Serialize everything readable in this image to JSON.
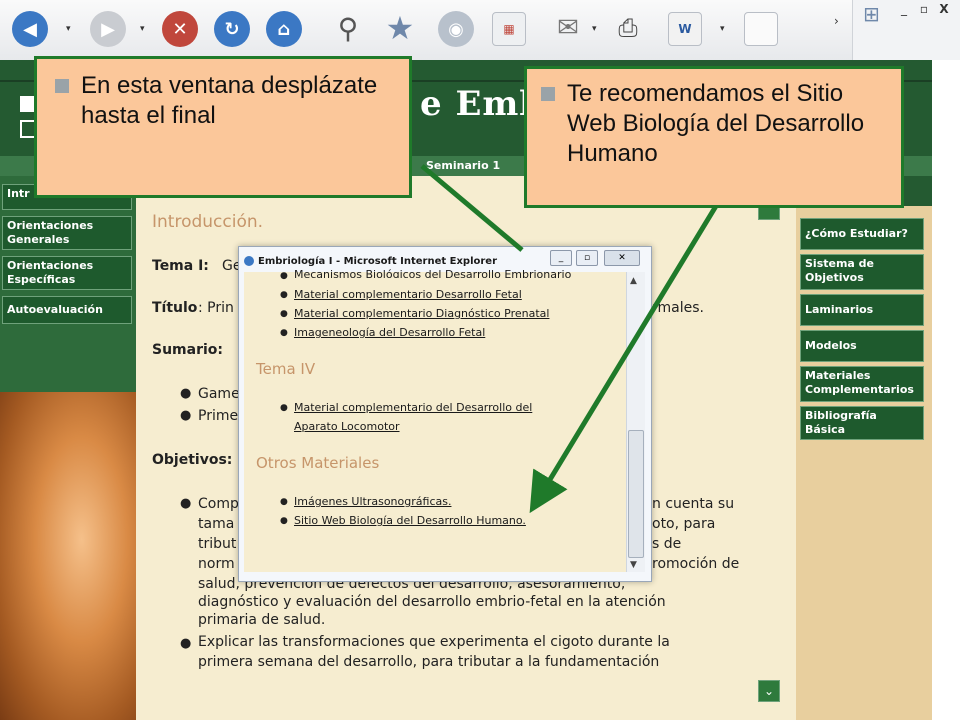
{
  "toolbar": {
    "icons": [
      "back-icon",
      "forward-icon",
      "stop-icon",
      "refresh-icon",
      "home-icon",
      "search-icon",
      "favorites-icon",
      "media-icon",
      "history-icon",
      "mail-icon",
      "print-icon",
      "edit-icon",
      "discuss-icon"
    ]
  },
  "window_controls": {
    "minimize": "_",
    "restore": "▫",
    "close": "X"
  },
  "site": {
    "header_title": "e Embr",
    "nav_tab": "Seminario 1",
    "left_nav": [
      "Intr",
      "Orientaciones Generales",
      "Orientaciones Específicas",
      "Autoevaluación"
    ],
    "right_nav": [
      "¿Cómo Estudiar?",
      "Sistema de Objetivos",
      "Laminarios",
      "Modelos",
      "Materiales Complementarios",
      "Bibliografía Básica"
    ]
  },
  "content": {
    "intro_title": "Introducción.",
    "tema_label": "Tema I:",
    "tema_value": "Ge",
    "titulo_label": "Título",
    "titulo_value": ": Prin",
    "titulo_tail": "rmales.",
    "sumario_label": "Sumario:",
    "sumario_items": [
      "Game",
      "Prime"
    ],
    "objetivos_label": "Objetivos:",
    "obj_frag": [
      "Comp",
      "tama",
      "tribut",
      "norm"
    ],
    "obj_tail": [
      "n cuenta su",
      "oto, para",
      "s de",
      "romoción de"
    ],
    "obj_lines": [
      "salud, prevención de defectos del desarrollo, asesoramiento,",
      "diagnóstico y evaluación del desarrollo embrio-fetal en la atención",
      "primaria de salud."
    ],
    "obj2_lines": [
      "Explicar las transformaciones que experimenta el cigoto durante la",
      "primera semana del desarrollo, para tributar a la fundamentación"
    ]
  },
  "popup": {
    "title": "Embriología I - Microsoft Internet Explorer",
    "top_links": [
      "Mecanismos Biológicos del Desarrollo Embrionario",
      "Material complementario Desarrollo Fetal",
      "Material complementario Diagnóstico Prenatal",
      "Imageneología del Desarrollo Fetal"
    ],
    "tema4_heading": "Tema IV",
    "tema4_links": [
      "Material complementario del Desarrollo del",
      "Aparato Locomotor"
    ],
    "otros_heading": "Otros Materiales",
    "otros_links": [
      "Imágenes Ultrasonográficas.",
      "Sitio Web Biología del Desarrollo Humano."
    ]
  },
  "callouts": {
    "left": "En esta ventana desplázate hasta el final",
    "right": "Te recomendamos el Sitio Web Biología del Desarrollo Humano"
  },
  "colors": {
    "site_green": "#2d6a3c",
    "callout_bg": "#fbc79a",
    "callout_border": "#1f7a2a",
    "arrow": "#1f7a2a"
  }
}
